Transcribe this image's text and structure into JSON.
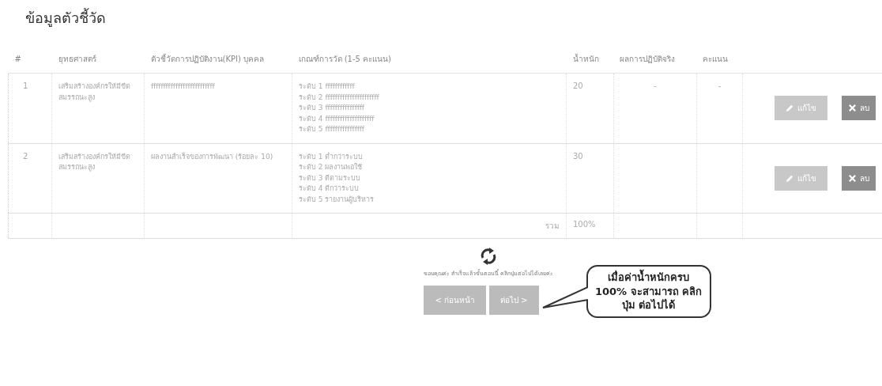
{
  "title": "ข้อมูลตัวชี้วัด",
  "table": {
    "columns": [
      "#",
      "ยุทธศาสตร์",
      "ตัวชี้วัดการปฏิบัติงาน(KPI) บุคคล",
      "เกณฑ์การวัด (1-5 คะแนน)",
      "น้ำหนัก",
      "ผลการปฏิบัติจริง",
      "คะแนน"
    ],
    "rows": [
      {
        "number": "1",
        "strategy": "เสริมสร้างองค์กรให้มีขีดสมรรถนะสูง",
        "kpi": "ffffffffffffffffffffffffff",
        "criteria": [
          "ระดับ 1 ffffffffffff",
          "ระดับ 2 ffffffffffffffffffffff",
          "ระดับ 3 ffffffffffffffff",
          "ระดับ 4 ffffffffffffffffffff",
          "ระดับ 5 ffffffffffffffff"
        ],
        "weight": "20",
        "result": "-",
        "score": "-",
        "edit": "แก้ไข",
        "delete": "ลบ"
      },
      {
        "number": "2",
        "strategy": "เสริมสร้างองค์กรให้มีขีดสมรรถนะสูง",
        "kpi": "ผลงานสำเร็จของการพัฒนา (ร้อยละ 10)",
        "criteria": [
          "ระดับ 1 ต่ำกว่าระบบ",
          "ระดับ 2 ผลงานพอใช้",
          "ระดับ 3 ดีตามระบบ",
          "ระดับ 4 ดีกว่าระบบ",
          "ระดับ 5 รายงานผู้บริหาร"
        ],
        "weight": "30",
        "result": "",
        "score": "",
        "edit": "แก้ไข",
        "delete": "ลบ"
      }
    ],
    "total": {
      "label": "รวม",
      "value": "100%"
    }
  },
  "message": "ขอบคุณค่ะ สำเร็จแล้วขั้นตอนนี้ คลิกปุ่มต่อไปได้เลยค่ะ",
  "buttons": [
    {
      "label": "< ก่อนหน้า"
    },
    {
      "label": "ต่อไป >"
    }
  ],
  "callout": "เมื่อค่าน้ำหนักครบ 100% จะสามารถ คลิกปุ่ม ต่อไปได้"
}
